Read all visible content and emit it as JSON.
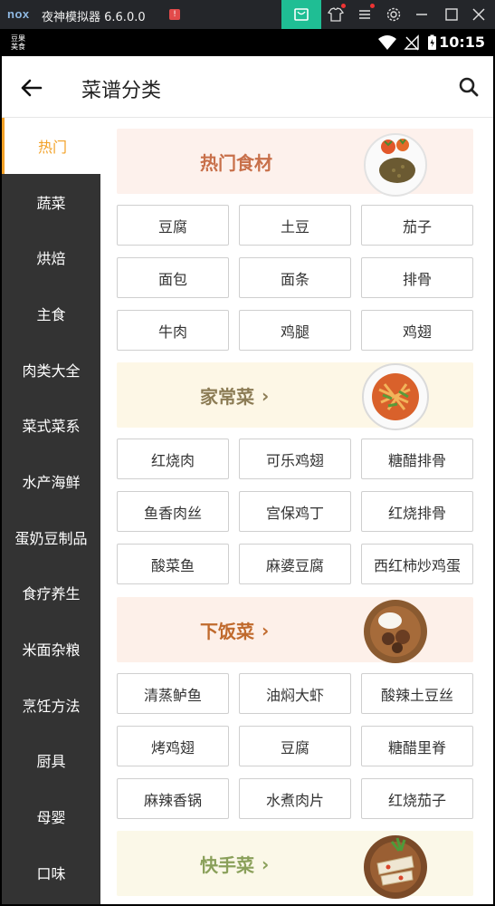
{
  "emulator": {
    "logo": "nox",
    "title": "夜神模拟器 6.6.0.0",
    "alert_badge": "!"
  },
  "status_bar": {
    "app_label_line1": "豆果",
    "app_label_line2": "美食",
    "time": "10:15"
  },
  "header": {
    "title": "菜谱分类"
  },
  "sidebar": {
    "items": [
      {
        "label": "热门"
      },
      {
        "label": "蔬菜"
      },
      {
        "label": "烘焙"
      },
      {
        "label": "主食"
      },
      {
        "label": "肉类大全"
      },
      {
        "label": "菜式菜系"
      },
      {
        "label": "水产海鲜"
      },
      {
        "label": "蛋奶豆制品"
      },
      {
        "label": "食疗养生"
      },
      {
        "label": "米面杂粮"
      },
      {
        "label": "烹饪方法"
      },
      {
        "label": "厨具"
      },
      {
        "label": "母婴"
      },
      {
        "label": "口味"
      }
    ]
  },
  "sections": [
    {
      "title": "热门食材",
      "has_chevron": false,
      "color": "#c8704a",
      "bg": "#fdf1ec",
      "tags": [
        "豆腐",
        "土豆",
        "茄子",
        "面包",
        "面条",
        "排骨",
        "牛肉",
        "鸡腿",
        "鸡翅"
      ]
    },
    {
      "title": "家常菜",
      "has_chevron": true,
      "color": "#8c7c55",
      "bg": "#fdf7e6",
      "tags": [
        "红烧肉",
        "可乐鸡翅",
        "糖醋排骨",
        "鱼香肉丝",
        "宫保鸡丁",
        "红烧排骨",
        "酸菜鱼",
        "麻婆豆腐",
        "西红柿炒鸡蛋"
      ]
    },
    {
      "title": "下饭菜",
      "has_chevron": true,
      "color": "#c06a2d",
      "bg": "#fdf0e9",
      "tags": [
        "清蒸鲈鱼",
        "油焖大虾",
        "酸辣土豆丝",
        "烤鸡翅",
        "豆腐",
        "糖醋里脊",
        "麻辣香锅",
        "水煮肉片",
        "红烧茄子"
      ]
    },
    {
      "title": "快手菜",
      "has_chevron": true,
      "color": "#8aa05a",
      "bg": "#fbf8e8",
      "tags": []
    }
  ],
  "colors": {
    "accent": "#f2a127",
    "sidebar_bg": "#333333",
    "emulator_bar": "#24262a",
    "bag_button": "#1fbe94"
  }
}
